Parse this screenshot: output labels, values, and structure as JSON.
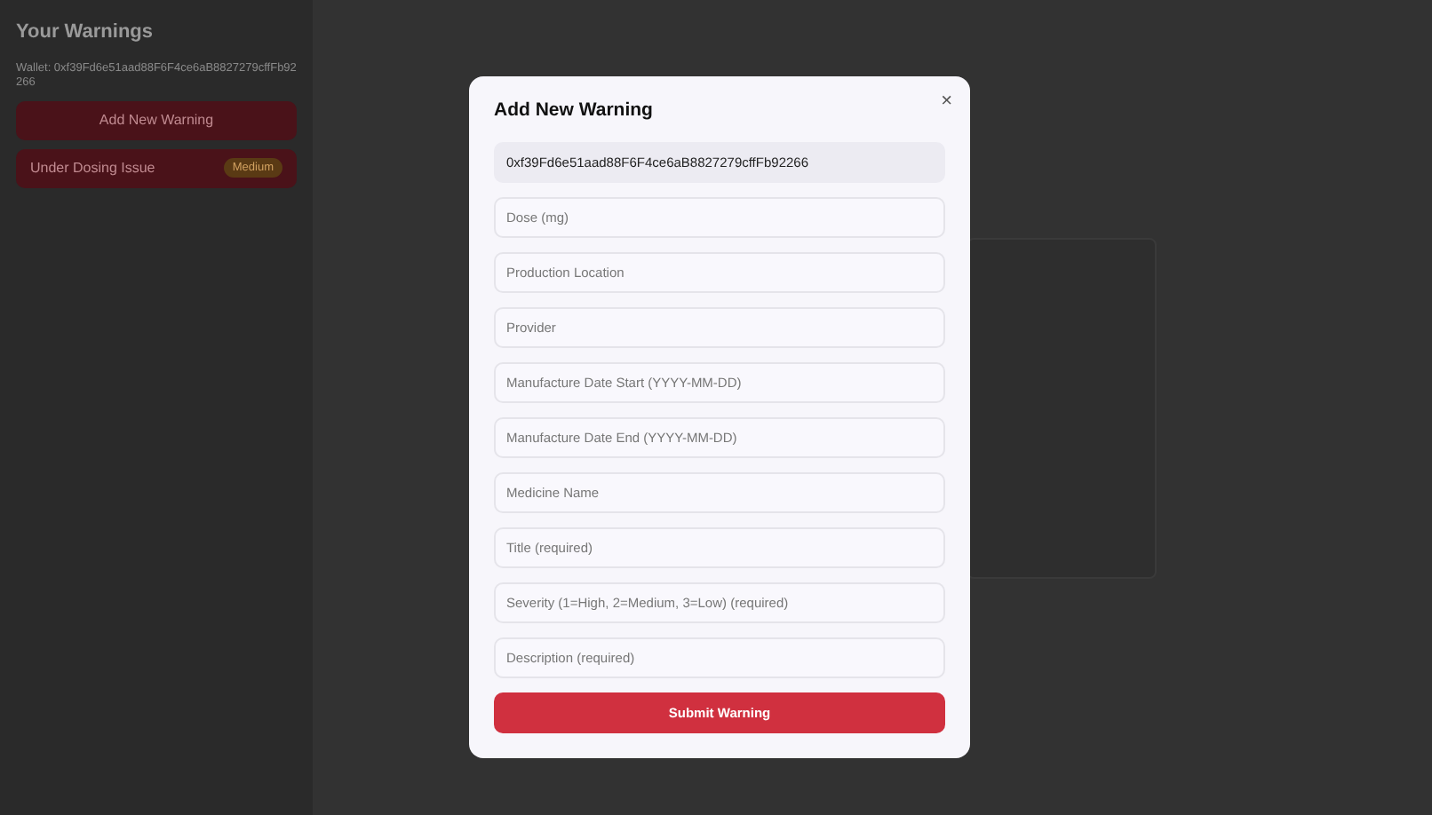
{
  "sidebar": {
    "title": "Your Warnings",
    "wallet": "Wallet: 0xf39Fd6e51aad88F6F4ce6aB8827279cffFb92266",
    "add_button": "Add New Warning",
    "warnings": [
      {
        "title": "Under Dosing Issue",
        "severity": "Medium",
        "selected": true
      }
    ]
  },
  "modal": {
    "title": "Add New Warning",
    "close": "×",
    "fields": [
      {
        "value": "0xf39Fd6e51aad88F6F4ce6aB8827279cffFb92266"
      },
      {
        "placeholder": "Dose (mg)"
      },
      {
        "placeholder": "Production Location"
      },
      {
        "placeholder": "Provider"
      },
      {
        "placeholder": "Manufacture Date Start (YYYY-MM-DD)"
      },
      {
        "placeholder": "Manufacture Date End (YYYY-MM-DD)"
      },
      {
        "placeholder": "Medicine Name"
      },
      {
        "placeholder": "Title (required)"
      },
      {
        "placeholder": "Severity (1=High, 2=Medium, 3=Low) (required)"
      },
      {
        "placeholder": "Description (required)"
      }
    ],
    "submit": "Submit Warning"
  }
}
